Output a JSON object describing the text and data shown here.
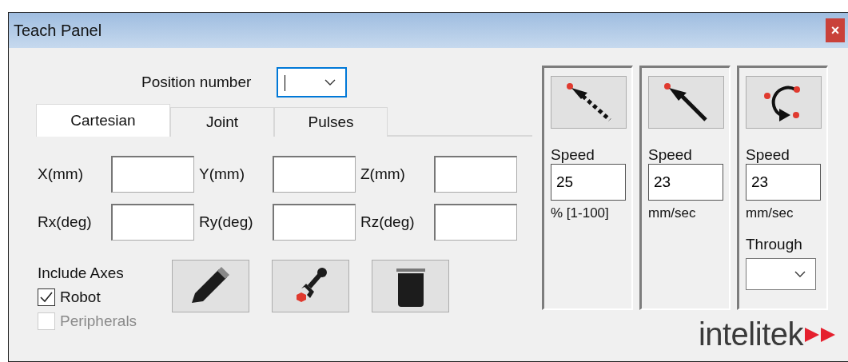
{
  "window": {
    "title": "Teach Panel",
    "close": "×"
  },
  "position": {
    "label": "Position number",
    "focused": true
  },
  "tabs": [
    {
      "label": "Cartesian",
      "selected": true
    },
    {
      "label": "Joint",
      "selected": false
    },
    {
      "label": "Pulses",
      "selected": false
    }
  ],
  "fields": [
    {
      "label": "X(mm)"
    },
    {
      "label": "Y(mm)"
    },
    {
      "label": "Z(mm)"
    },
    {
      "label": "Rx(deg)"
    },
    {
      "label": "Ry(deg)"
    },
    {
      "label": "Rz(deg)"
    }
  ],
  "include_axes": {
    "label": "Include Axes",
    "items": [
      {
        "label": "Robot",
        "checked": true,
        "disabled": false
      },
      {
        "label": "Peripherals",
        "checked": false,
        "disabled": true
      }
    ]
  },
  "motions": [
    {
      "kind": "joint",
      "speed_label": "Speed",
      "speed": "25",
      "unit": "% [1-100]"
    },
    {
      "kind": "linear",
      "speed_label": "Speed",
      "speed": "23",
      "unit": "mm/sec"
    },
    {
      "kind": "circular",
      "speed_label": "Speed",
      "speed": "23",
      "unit": "mm/sec",
      "through_label": "Through"
    }
  ],
  "logo": {
    "text": "intelitek"
  }
}
